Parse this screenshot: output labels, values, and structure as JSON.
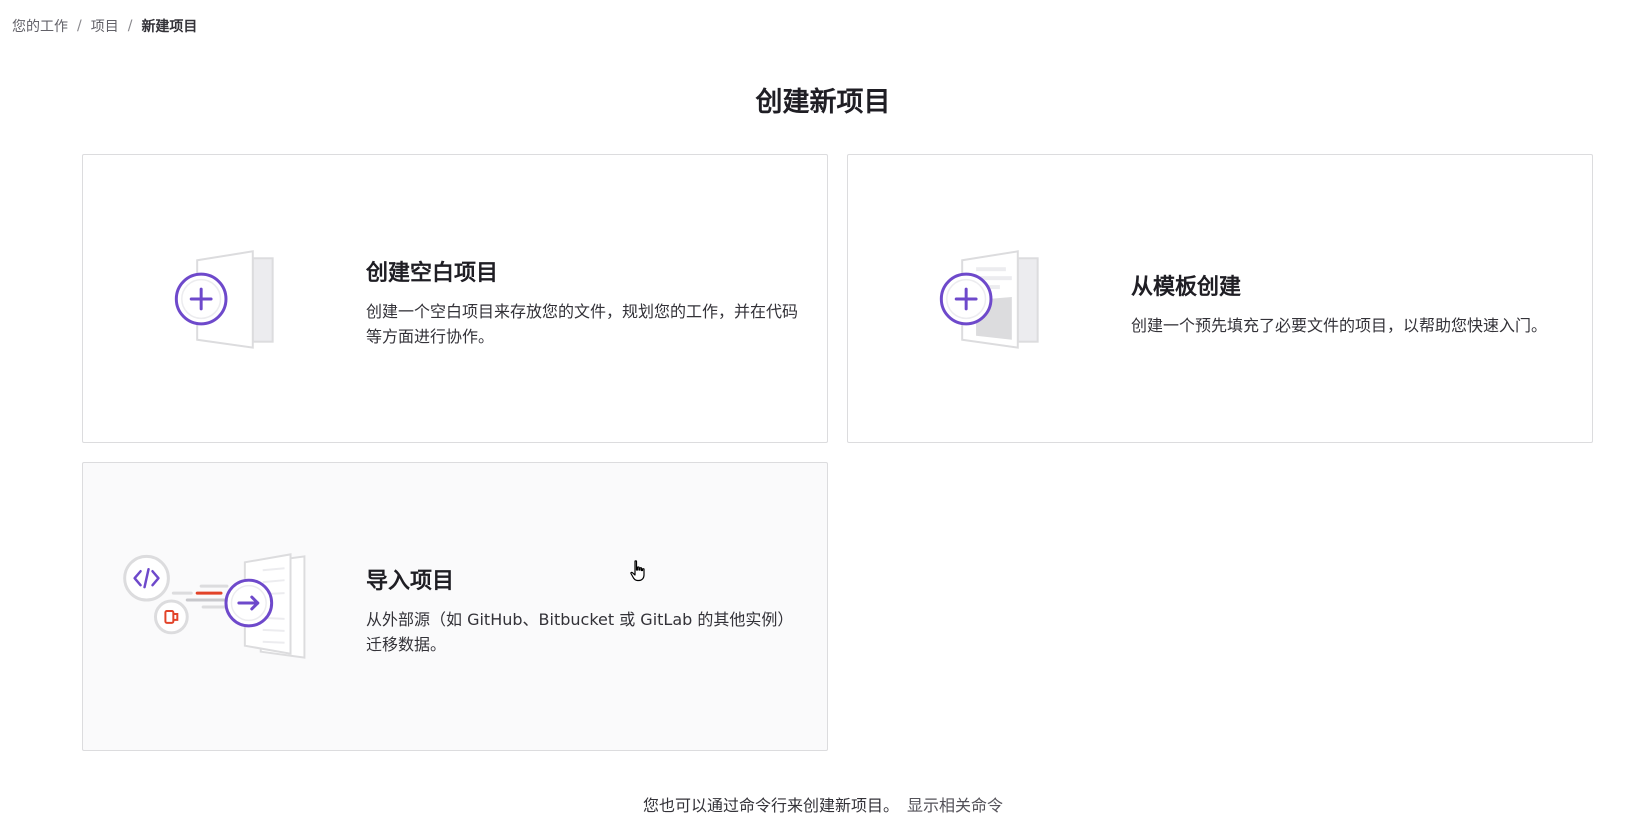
{
  "breadcrumb": {
    "items": [
      "您的工作",
      "项目"
    ],
    "current": "新建项目",
    "separator": "/"
  },
  "page": {
    "title": "创建新项目"
  },
  "cards": {
    "blank": {
      "title": "创建空白项目",
      "description": "创建一个空白项目来存放您的文件，规划您的工作，并在代码等方面进行协作。",
      "icon": "plus-document-icon"
    },
    "template": {
      "title": "从模板创建",
      "description": "创建一个预先填充了必要文件的项目，以帮助您快速入门。",
      "icon": "template-document-icon"
    },
    "import": {
      "title": "导入项目",
      "description": "从外部源（如 GitHub、Bitbucket 或 GitLab 的其他实例）迁移数据。",
      "icon": "import-arrow-icon"
    }
  },
  "footer": {
    "text": "您也可以通过命令行来创建新项目。",
    "link": "显示相关命令"
  },
  "colors": {
    "accent": "#6e49cb",
    "border": "#dcdcde",
    "orange": "#e24329"
  }
}
